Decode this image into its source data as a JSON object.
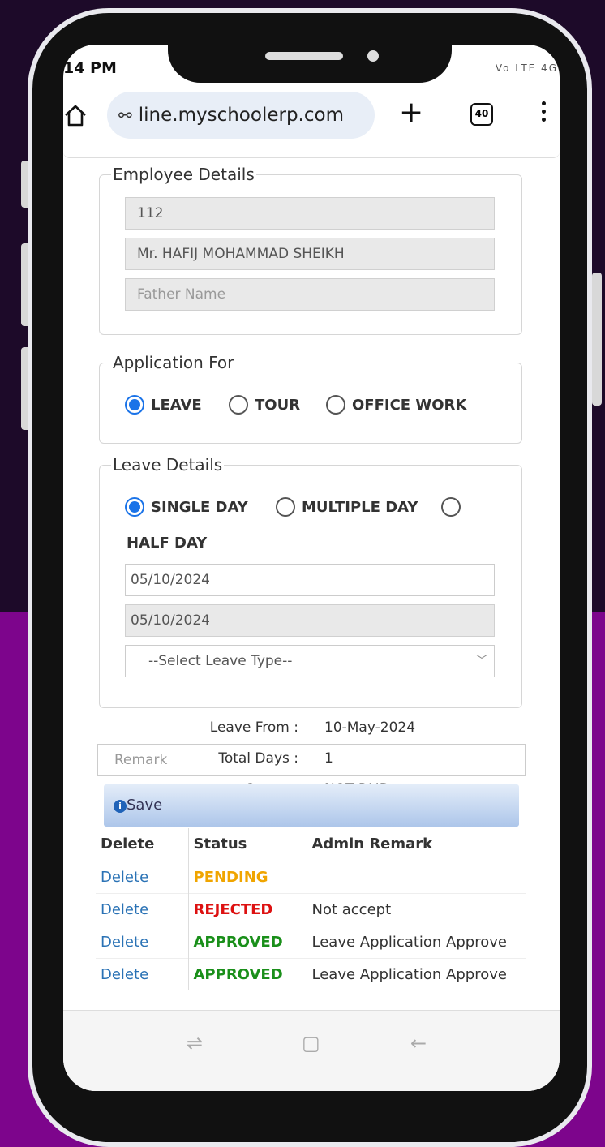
{
  "status_bar": {
    "time": "14 PM",
    "icons": "Vo LTE 4G"
  },
  "browser": {
    "url": "line.myschoolerp.com",
    "tab_count": "40"
  },
  "employee_details": {
    "legend": "Employee Details",
    "employee_id": "112",
    "employee_name": "Mr. HAFIJ MOHAMMAD SHEIKH",
    "father_name_placeholder": "Father Name"
  },
  "application_for": {
    "legend": "Application For",
    "options": [
      "LEAVE",
      "TOUR",
      "OFFICE WORK"
    ],
    "selected": "LEAVE"
  },
  "leave_details": {
    "legend": "Leave Details",
    "options": [
      "SINGLE DAY",
      "MULTIPLE DAY",
      "HALF DAY"
    ],
    "selected": "SINGLE DAY",
    "from_date": "05/10/2024",
    "to_date": "05/10/2024",
    "leave_type_placeholder": "--Select Leave Type--"
  },
  "summary": {
    "leave_from_label": "Leave From :",
    "leave_from_value": "10-May-2024",
    "total_days_label": "Total Days :",
    "total_days_value": "1",
    "status_label": "Status :",
    "status_value": "NOT PAID"
  },
  "remark_placeholder": "Remark",
  "save_label": "Save",
  "table": {
    "headers": [
      "Delete",
      "Status",
      "Admin Remark"
    ],
    "rows": [
      {
        "delete": "Delete",
        "status": "PENDING",
        "remark": ""
      },
      {
        "delete": "Delete",
        "status": "REJECTED",
        "remark": "Not accept"
      },
      {
        "delete": "Delete",
        "status": "APPROVED",
        "remark": "Leave Application Approve"
      },
      {
        "delete": "Delete",
        "status": "APPROVED",
        "remark": "Leave Application Approve"
      }
    ]
  },
  "colors": {
    "background_top": "#1d0a29",
    "background_bottom": "#7d058c",
    "radio_accent": "#1a73e8",
    "pending": "#f0a500",
    "rejected": "#d11111",
    "approved": "#1a8f1a"
  }
}
